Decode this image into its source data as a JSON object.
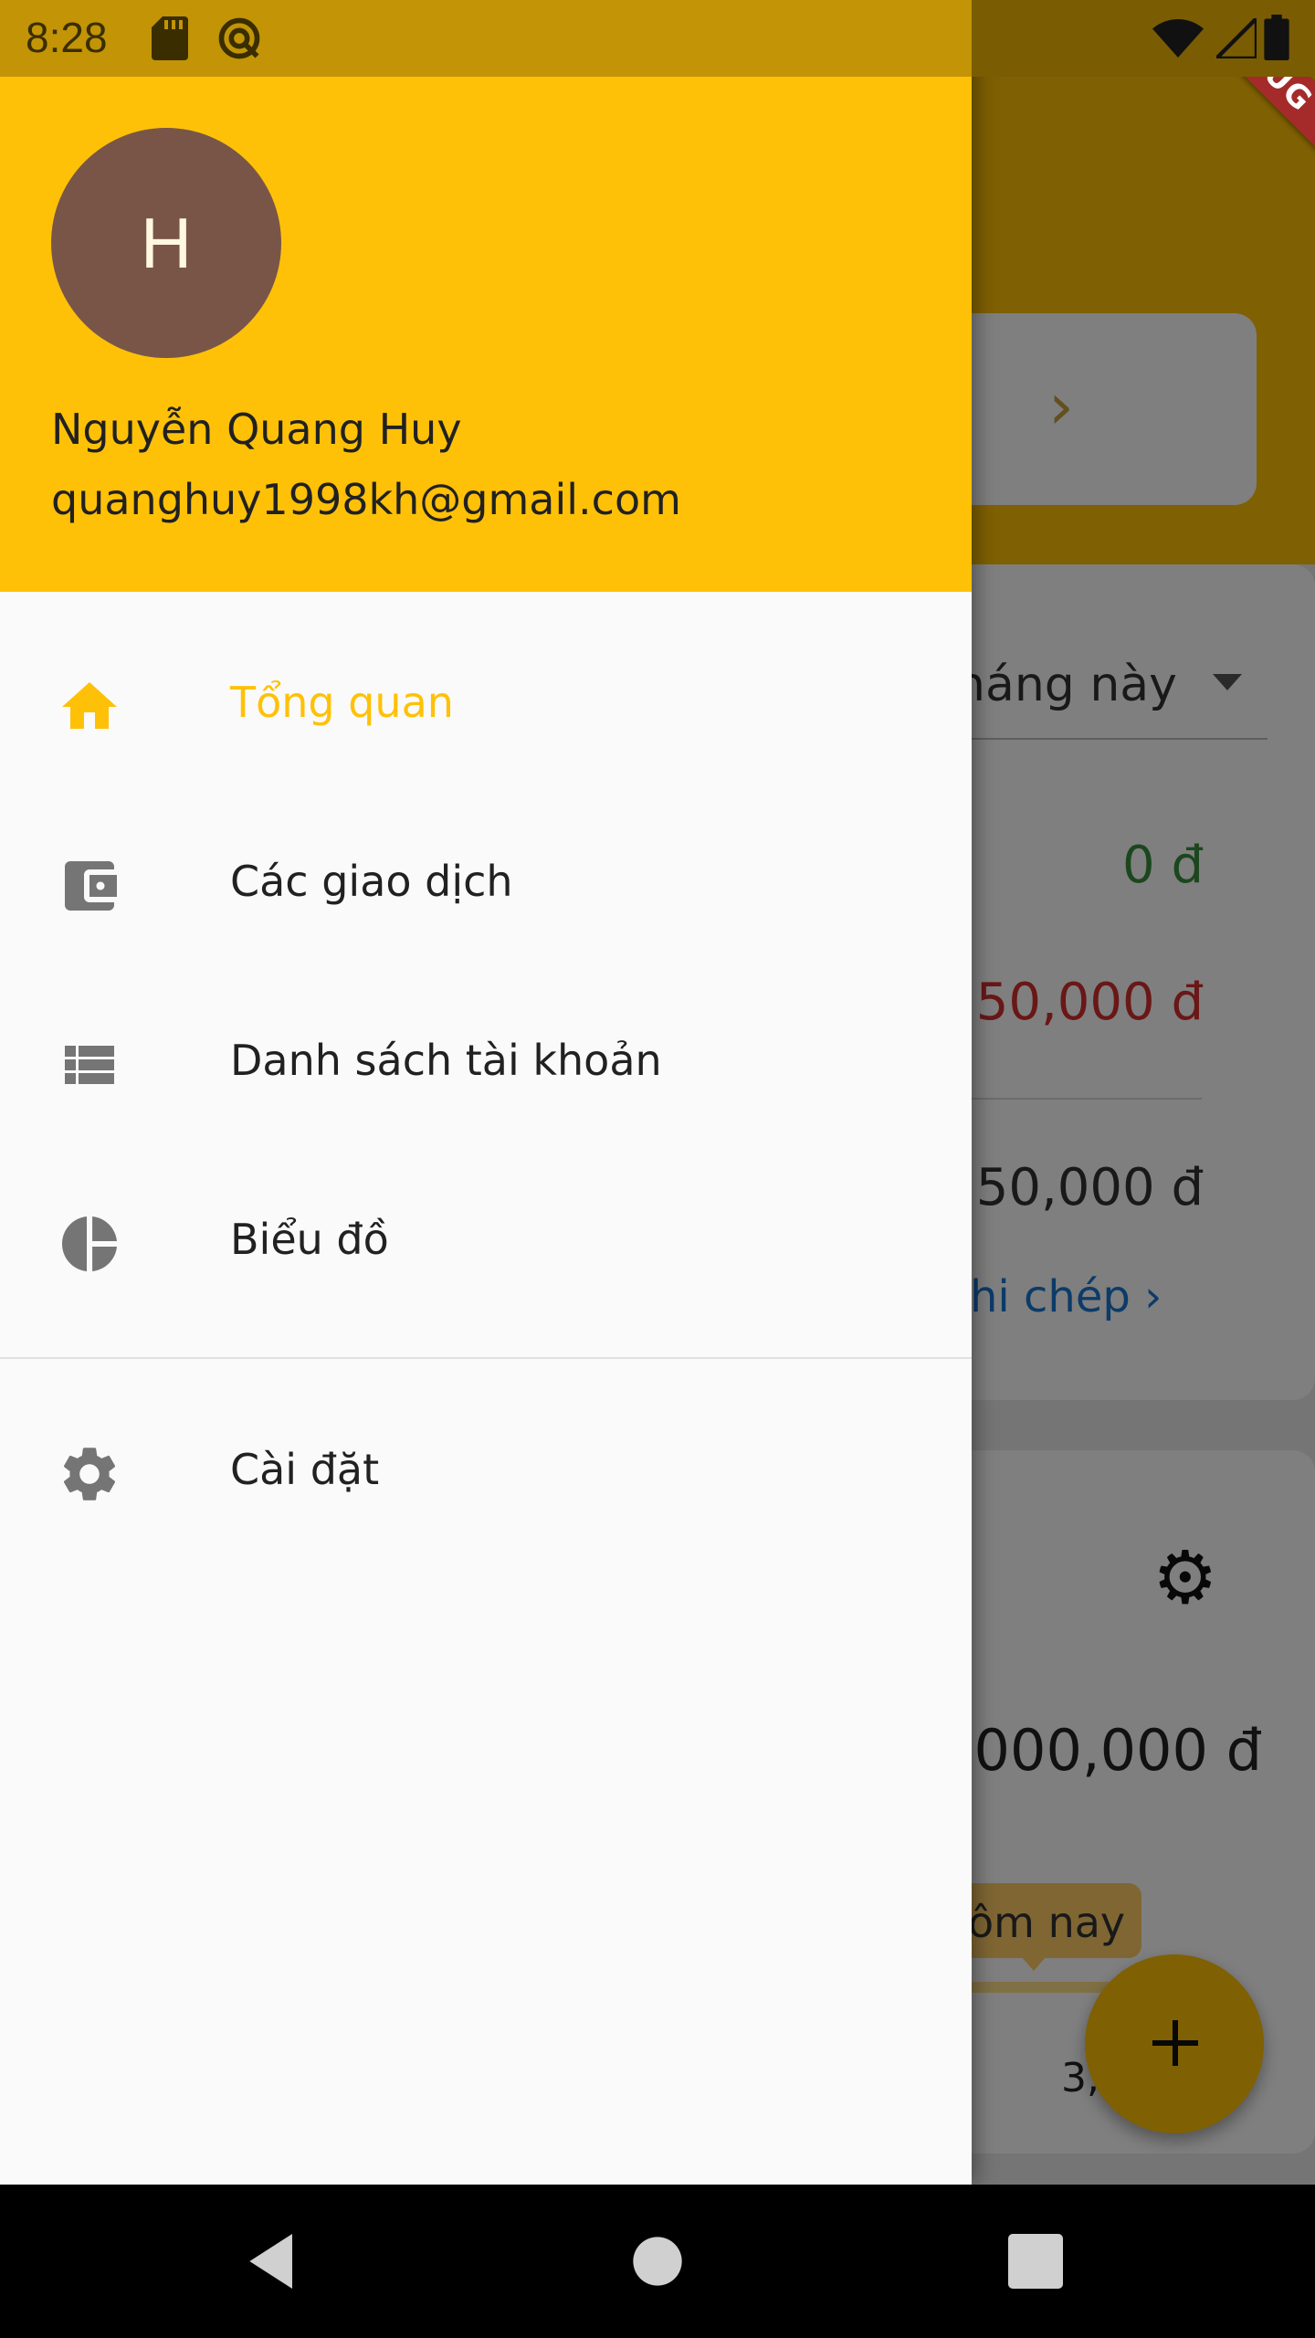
{
  "status_bar": {
    "time": "8:28"
  },
  "debug_banner": "DEBUG",
  "background": {
    "period_selector": "háng này",
    "income": "0 đ",
    "expense": "50,000 đ",
    "balance": "50,000 đ",
    "record_link": "hi chép",
    "total_amount": "000,000 đ",
    "tooltip": "ôm nay",
    "small_value": "3,",
    "colors": {
      "income": "#388e3c",
      "expense": "#d32f2f",
      "link": "#1976d2"
    }
  },
  "drawer": {
    "avatar_initial": "H",
    "user_name": "Nguyễn Quang Huy",
    "user_email": "quanghuy1998kh@gmail.com",
    "items": [
      {
        "label": "Tổng quan",
        "icon": "home-icon",
        "active": true
      },
      {
        "label": "Các giao dịch",
        "icon": "wallet-icon",
        "active": false
      },
      {
        "label": "Danh sách tài khoản",
        "icon": "list-icon",
        "active": false
      },
      {
        "label": "Biểu đồ",
        "icon": "pie-chart-icon",
        "active": false
      },
      {
        "label": "Cài đặt",
        "icon": "settings-icon",
        "active": false
      }
    ]
  },
  "colors": {
    "accent": "#ffc107",
    "avatar_bg": "#795548",
    "icon_gray": "#757575"
  }
}
